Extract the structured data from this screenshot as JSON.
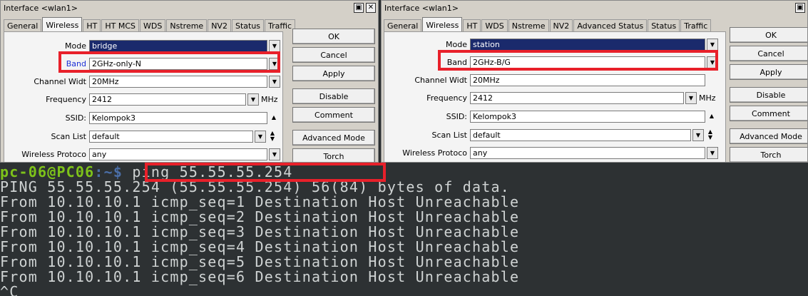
{
  "left_window": {
    "title": "Interface <wlan1>",
    "minimize_glyph": "▣",
    "close_glyph": "✕",
    "tabs": [
      "General",
      "Wireless",
      "HT",
      "HT MCS",
      "WDS",
      "Nstreme",
      "NV2",
      "Status",
      "Traffic"
    ],
    "active_tab": "Wireless",
    "fields": {
      "mode": {
        "label": "Mode",
        "value": "bridge"
      },
      "band": {
        "label": "Band",
        "value": "2GHz-only-N"
      },
      "channel_width": {
        "label": "Channel Widt",
        "value": "20MHz"
      },
      "frequency": {
        "label": "Frequency",
        "value": "2412",
        "unit": "MHz"
      },
      "ssid": {
        "label": "SSID:",
        "value": "Kelompok3"
      },
      "scan_list": {
        "label": "Scan List",
        "value": "default"
      },
      "wireless_protocol": {
        "label": "Wireless Protoco",
        "value": "any"
      }
    },
    "buttons": [
      "OK",
      "Cancel",
      "Apply",
      "Disable",
      "Comment",
      "Advanced Mode",
      "Torch"
    ]
  },
  "right_window": {
    "title": "Interface <wlan1>",
    "close_glyph": "▣",
    "tabs": [
      "General",
      "Wireless",
      "HT",
      "WDS",
      "Nstreme",
      "NV2",
      "Advanced Status",
      "Status",
      "Traffic"
    ],
    "active_tab": "Wireless",
    "fields": {
      "mode": {
        "label": "Mode",
        "value": "station"
      },
      "band": {
        "label": "Band",
        "value": "2GHz-B/G"
      },
      "channel_width": {
        "label": "Channel Widt",
        "value": "20MHz"
      },
      "frequency": {
        "label": "Frequency",
        "value": "2412",
        "unit": "MHz"
      },
      "ssid": {
        "label": "SSID:",
        "value": "Kelompok3"
      },
      "scan_list": {
        "label": "Scan List",
        "value": "default"
      },
      "wireless_protocol": {
        "label": "Wireless Protoco",
        "value": "any"
      }
    },
    "buttons": [
      "OK",
      "Cancel",
      "Apply",
      "Disable",
      "Comment",
      "Advanced Mode",
      "Torch"
    ]
  },
  "terminal": {
    "prompt_user": "pc-06@PC06",
    "prompt_path": ":~$",
    "command": " ping 55.55.55.254",
    "lines": [
      "PING 55.55.55.254 (55.55.55.254) 56(84) bytes of data.",
      "From 10.10.10.1 icmp_seq=1 Destination Host Unreachable",
      "From 10.10.10.1 icmp_seq=2 Destination Host Unreachable",
      "From 10.10.10.1 icmp_seq=3 Destination Host Unreachable",
      "From 10.10.10.1 icmp_seq=4 Destination Host Unreachable",
      "From 10.10.10.1 icmp_seq=5 Destination Host Unreachable",
      "From 10.10.10.1 icmp_seq=6 Destination Host Unreachable",
      "^C"
    ]
  },
  "colors": {
    "highlight": "#e8202a",
    "selected_field": "#1a2a6c",
    "terminal_bg": "#2d3133",
    "prompt_green": "#7ec31a",
    "prompt_blue": "#4b6fa8"
  }
}
